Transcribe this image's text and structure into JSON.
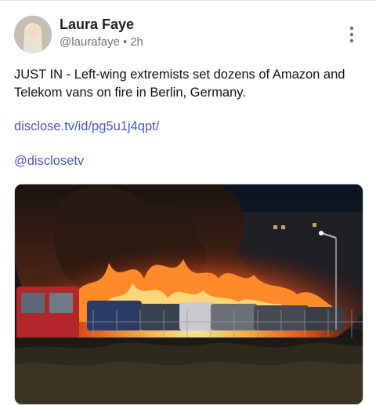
{
  "post": {
    "author_name": "Laura Faye",
    "handle": "@laurafaye",
    "time_ago": "2h",
    "text": "JUST IN - Left-wing extremists set dozens of Amazon and Telekom vans on fire in Berlin, Germany.",
    "link": "disclose.tv/id/pg5u1j4qpt/",
    "mention": "@disclosetv"
  },
  "icons": {
    "more": "more-vertical-icon",
    "avatar": "avatar-photo"
  },
  "colors": {
    "link": "#4a57c8",
    "meta": "#6f7278",
    "name": "#1f1f24"
  }
}
